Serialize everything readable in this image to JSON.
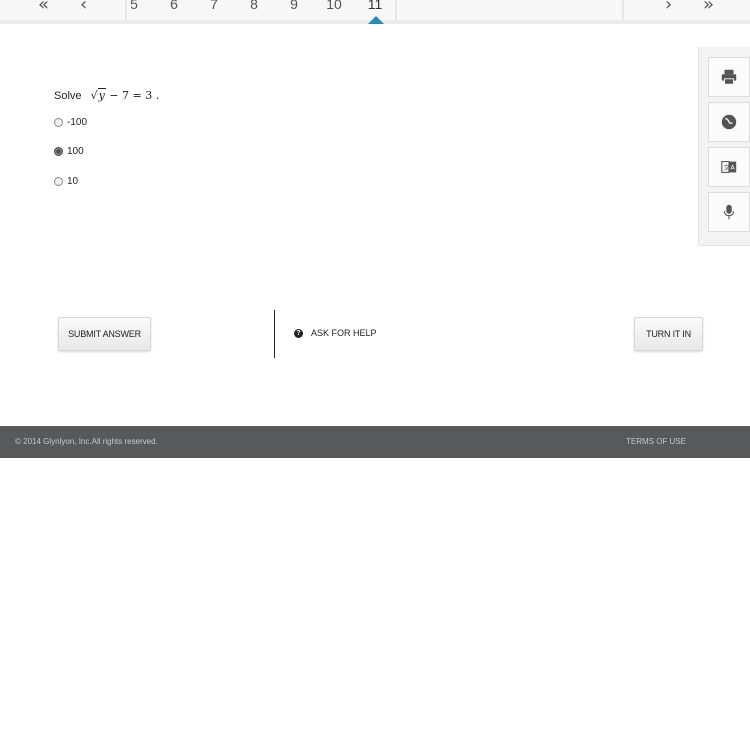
{
  "pager": {
    "first_icon": "double-chevron-left-icon",
    "prev_icon": "chevron-left-icon",
    "next_icon": "chevron-right-icon",
    "last_icon": "double-chevron-right-icon",
    "first_glyph": "«",
    "prev_glyph": "‹",
    "next_glyph": "›",
    "last_glyph": "»",
    "pages": [
      "5",
      "6",
      "7",
      "8",
      "9",
      "10",
      "11"
    ],
    "active_page": "11",
    "accent_color": "#2a8bb0"
  },
  "question": {
    "prompt": "Solve",
    "equation": {
      "radicand": "y",
      "rest": " − 7 = 3 ."
    },
    "options": [
      {
        "label": "-100",
        "selected": false
      },
      {
        "label": "100",
        "selected": true
      },
      {
        "label": "10",
        "selected": false
      }
    ]
  },
  "tools": [
    {
      "name": "print",
      "icon": "printer-icon"
    },
    {
      "name": "language",
      "icon": "globe-icon"
    },
    {
      "name": "translate",
      "icon": "translate-icon"
    },
    {
      "name": "audio",
      "icon": "microphone-icon"
    }
  ],
  "actions": {
    "submit_label": "SUBMIT ANSWER",
    "help_label": "ASK FOR HELP",
    "help_icon_glyph": "?",
    "turn_in_label": "TURN IT IN"
  },
  "footer": {
    "copyright": "© 2014 Glynlyon, Inc.All rights reserved.",
    "terms_label": "TERMS OF USE"
  }
}
